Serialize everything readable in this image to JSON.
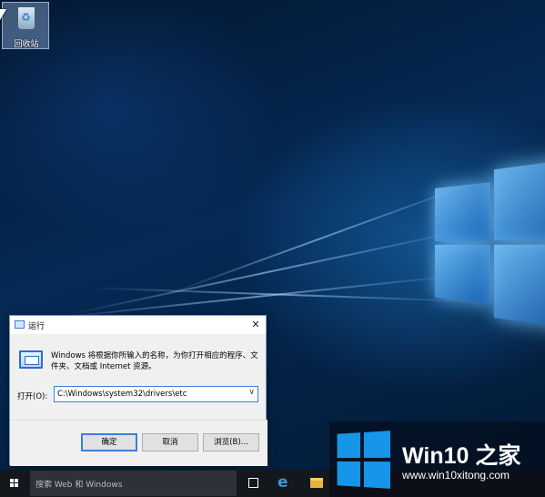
{
  "desktop": {
    "recycle_bin_label": "回收站"
  },
  "run_dialog": {
    "title": "运行",
    "close_glyph": "✕",
    "description": "Windows 将根据你所输入的名称，为你打开相应的程序、文件夹、文档或 Internet 资源。",
    "open_label": "打开(O):",
    "open_value": "C:\\Windows\\system32\\drivers\\etc",
    "dropdown_glyph": "∨",
    "buttons": {
      "ok": "确定",
      "cancel": "取消",
      "browse": "浏览(B)..."
    }
  },
  "taskbar": {
    "search_placeholder": "搜索 Web 和 Windows",
    "edge_glyph": "e"
  },
  "watermark": {
    "title": "Win10 之家",
    "url": "www.win10xitong.com"
  },
  "colors": {
    "accent": "#3c7fd8",
    "taskbar": "#14171c",
    "watermark_logo": "#1596e8"
  },
  "icons": [
    "recycle-bin-icon",
    "run-icon",
    "close-icon",
    "chevron-down-icon",
    "windows-start-icon",
    "task-view-icon",
    "edge-icon",
    "file-explorer-icon",
    "windows-logo-icon"
  ]
}
